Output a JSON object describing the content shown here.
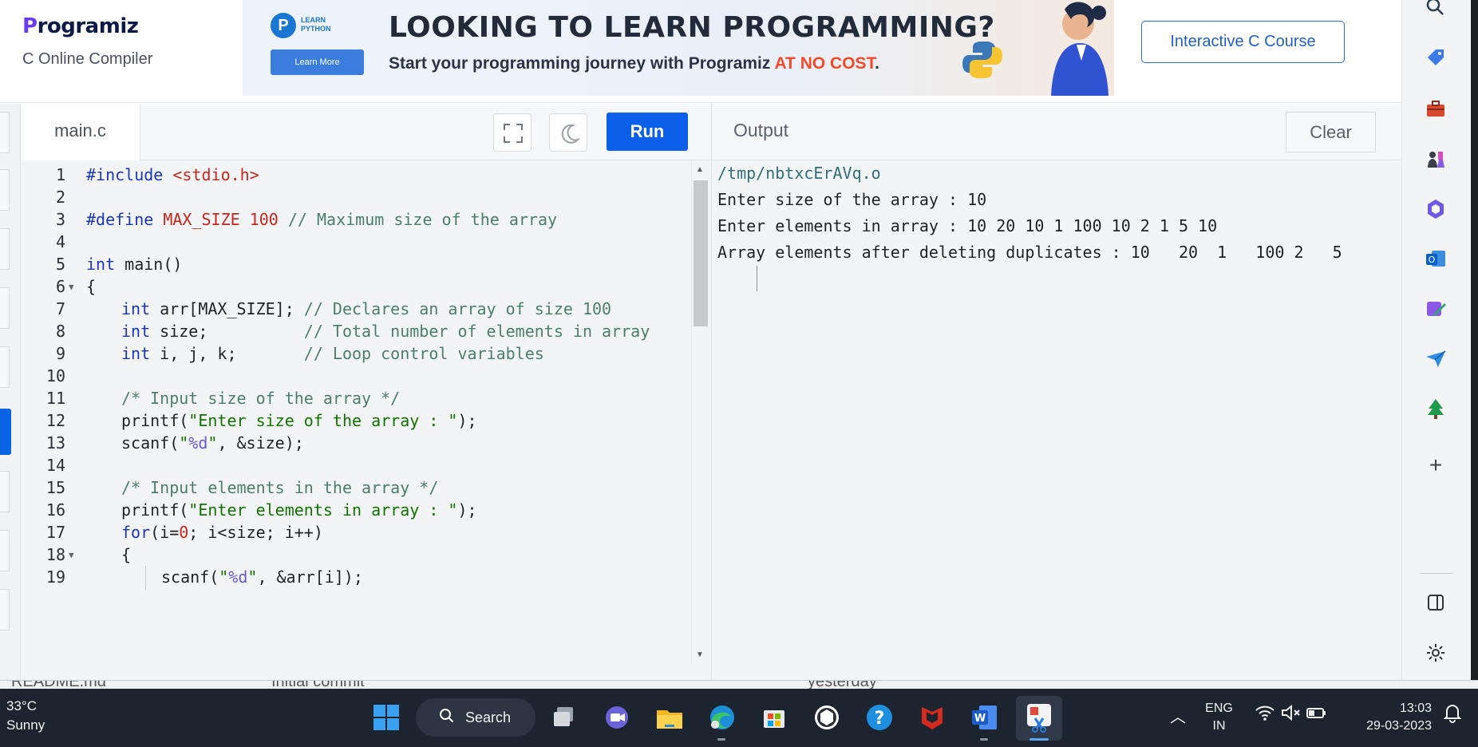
{
  "header": {
    "logo_text": "rogramiz",
    "logo_initial": "P",
    "subtitle": "C Online Compiler",
    "course_button": "Interactive C Course"
  },
  "banner": {
    "badge_letter": "P",
    "badge_text": "LEARN PYTHON",
    "learn_more": "Learn More",
    "headline": "LOOKING TO LEARN PROGRAMMING?",
    "tagline_prefix": "Start your programming journey with Programiz ",
    "tagline_highlight": "AT NO COST",
    "tagline_suffix": "."
  },
  "editor": {
    "tab_file": "main.c",
    "run_label": "Run",
    "lines": [
      {
        "n": "1"
      },
      {
        "n": "2"
      },
      {
        "n": "3"
      },
      {
        "n": "4"
      },
      {
        "n": "5"
      },
      {
        "n": "6"
      },
      {
        "n": "7"
      },
      {
        "n": "8"
      },
      {
        "n": "9"
      },
      {
        "n": "10"
      },
      {
        "n": "11"
      },
      {
        "n": "12"
      },
      {
        "n": "13"
      },
      {
        "n": "14"
      },
      {
        "n": "15"
      },
      {
        "n": "16"
      },
      {
        "n": "17"
      },
      {
        "n": "18"
      },
      {
        "n": "19"
      }
    ],
    "code": {
      "l1_a": "#include",
      "l1_b": " <stdio.h>",
      "l3_a": "#define",
      "l3_b": " MAX_SIZE",
      "l3_c": " 100",
      "l3_d": " // Maximum size of the array",
      "l5_a": "int",
      "l5_b": " main()",
      "l6": "{",
      "l7_a": "int",
      "l7_b": " arr[MAX_SIZE]; ",
      "l7_c": "// Declares an array of size 100",
      "l8_a": "int",
      "l8_b": " size;          ",
      "l8_c": "// Total number of elements in array",
      "l9_a": "int",
      "l9_b": " i, j, k;       ",
      "l9_c": "// Loop control variables",
      "l11": "/* Input size of the array */",
      "l12_a": "printf(",
      "l12_b": "\"Enter size of the array : \"",
      "l12_c": ");",
      "l13_a": "scanf(",
      "l13_b": "\"",
      "l13_c": "%d",
      "l13_d": "\"",
      "l13_e": ", &size);",
      "l15": "/* Input elements in the array */",
      "l16_a": "printf(",
      "l16_b": "\"Enter elements in array : \"",
      "l16_c": ");",
      "l17_a": "for",
      "l17_b": "(i=",
      "l17_c": "0",
      "l17_d": "; i<size; i++)",
      "l18": "{",
      "l19_a": "scanf(",
      "l19_b": "\"",
      "l19_c": "%d",
      "l19_d": "\"",
      "l19_e": ", &arr[i]);"
    }
  },
  "output": {
    "label": "Output",
    "clear_label": "Clear",
    "lines": [
      "/tmp/nbtxcErAVq.o",
      "Enter size of the array : 10",
      "Enter elements in array : 10 20 10 1 100 10 2 1 5 10",
      "Array elements after deleting duplicates : 10   20  1   100 2   5"
    ]
  },
  "behind": {
    "file": "README.md",
    "commit": "Initial commit",
    "when": "yesterday"
  },
  "taskbar": {
    "temperature": "33°C",
    "condition": "Sunny",
    "search_label": "Search",
    "lang_top": "ENG",
    "lang_bottom": "IN",
    "time": "13:03",
    "date": "29-03-2023"
  },
  "colors": {
    "run_button": "#0b5fe8",
    "brand": "#6a3cf0",
    "tagline_highlight": "#ee4b2b"
  }
}
